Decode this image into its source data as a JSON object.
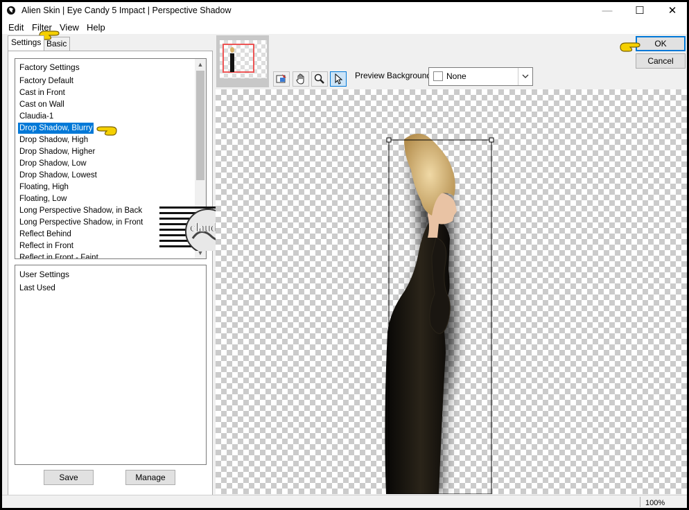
{
  "window": {
    "title": "Alien Skin | Eye Candy 5 Impact | Perspective Shadow",
    "min_glyph": "—",
    "max_glyph": "☐",
    "close_glyph": "✕"
  },
  "menu": [
    "Edit",
    "Filter",
    "View",
    "Help"
  ],
  "tabs": [
    "Settings",
    "Basic"
  ],
  "factory_settings": {
    "header": "Factory Settings",
    "items": [
      "Factory Default",
      "Cast in Front",
      "Cast on Wall",
      "Claudia-1",
      "Drop Shadow, Blurry",
      "Drop Shadow, High",
      "Drop Shadow, Higher",
      "Drop Shadow, Low",
      "Drop Shadow, Lowest",
      "Floating, High",
      "Floating, Low",
      "Long Perspective Shadow, in Back",
      "Long Perspective Shadow, in Front",
      "Reflect Behind",
      "Reflect in Front",
      "Reflect in Front - Faint"
    ],
    "selected_index": 4
  },
  "user_settings": {
    "header": "User Settings",
    "items": [
      "Last Used"
    ]
  },
  "buttons": {
    "save": "Save",
    "manage": "Manage",
    "ok": "OK",
    "cancel": "Cancel"
  },
  "preview": {
    "background_label": "Preview Background:",
    "background_value": "None"
  },
  "watermark": "claudia",
  "status": {
    "zoom": "100%"
  },
  "colors": {
    "selection": "#0078d7",
    "pointer": "#f5d000"
  },
  "icons": [
    "app-icon",
    "navigator-icon",
    "hand-icon",
    "zoom-icon",
    "arrow-pointer-icon",
    "chevron-down-icon",
    "scroll-up-icon",
    "scroll-down-icon",
    "hand-pointer-icon"
  ]
}
